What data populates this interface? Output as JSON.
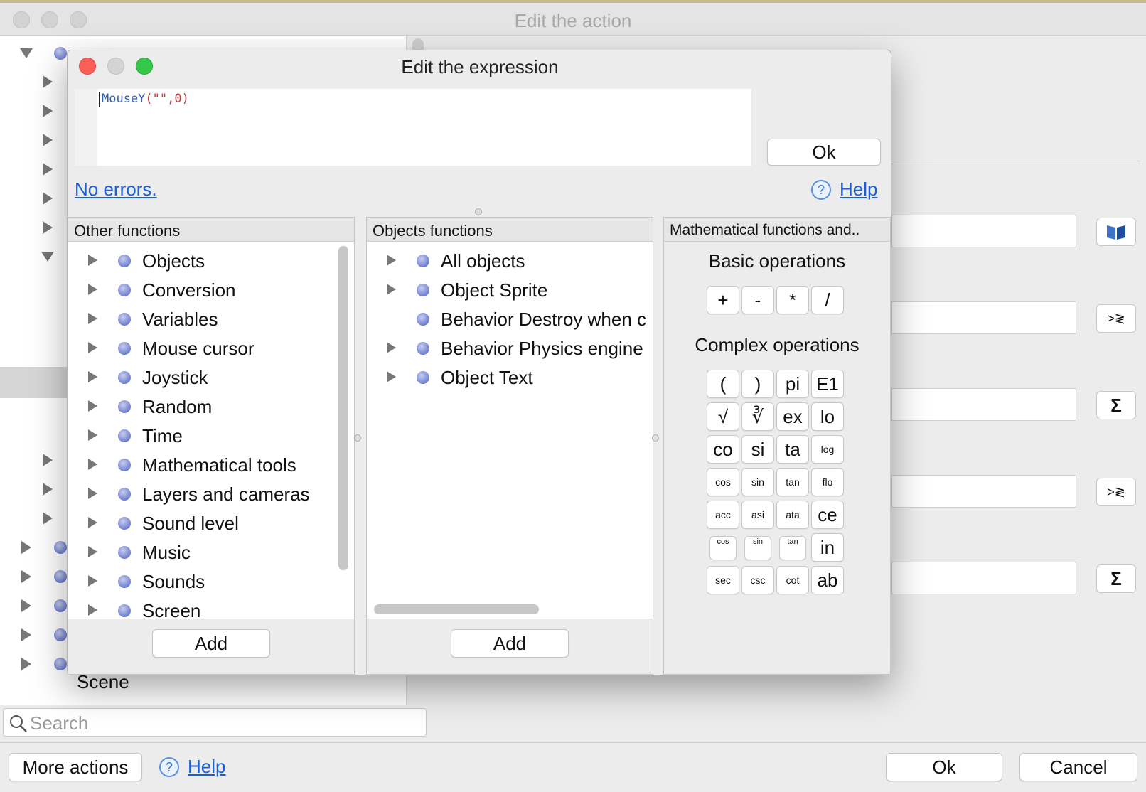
{
  "window": {
    "title": "Edit the action"
  },
  "background_tree": {
    "last_item": "Scene",
    "search_placeholder": "Search"
  },
  "bottom_bar": {
    "more_actions": "More actions",
    "help": "Help",
    "ok": "Ok",
    "cancel": "Cancel"
  },
  "right_buttons": [
    "book-icon",
    "compare-icon",
    "sigma-icon",
    "compare-icon",
    "sigma-icon"
  ],
  "dialog": {
    "title": "Edit the expression",
    "expression": "MouseY(\"\",0)",
    "status": "No errors.",
    "help": "Help",
    "ok": "Ok",
    "other_functions": {
      "header": "Other functions",
      "items": [
        "Objects",
        "Conversion",
        "Variables",
        "Mouse cursor",
        "Joystick",
        "Random",
        "Time",
        "Mathematical tools",
        "Layers and cameras",
        "Sound level",
        "Music",
        "Sounds",
        "Screen"
      ],
      "add": "Add"
    },
    "objects_functions": {
      "header": "Objects functions",
      "items": [
        {
          "label": "All objects",
          "expandable": true
        },
        {
          "label": "Object Sprite",
          "expandable": true
        },
        {
          "label": "Behavior Destroy when c",
          "expandable": false
        },
        {
          "label": "Behavior Physics engine",
          "expandable": true
        },
        {
          "label": "Object Text",
          "expandable": true
        }
      ],
      "add": "Add"
    },
    "math_functions": {
      "header": "Mathematical functions and..",
      "basic_title": "Basic operations",
      "basic": [
        "+",
        "-",
        "*",
        "/"
      ],
      "complex_title": "Complex operations",
      "complex": [
        [
          "(",
          ")",
          "pi",
          "E1"
        ],
        [
          "√",
          "∛",
          "ex",
          "lo"
        ],
        [
          "co",
          "si",
          "ta",
          "log"
        ],
        [
          "cos",
          "sin",
          "tan",
          "flo"
        ],
        [
          "acc",
          "asi",
          "ata",
          "ce"
        ],
        [
          "cos",
          "sin",
          "tan",
          "in"
        ],
        [
          "sec",
          "csc",
          "cot",
          "ab"
        ]
      ]
    }
  }
}
